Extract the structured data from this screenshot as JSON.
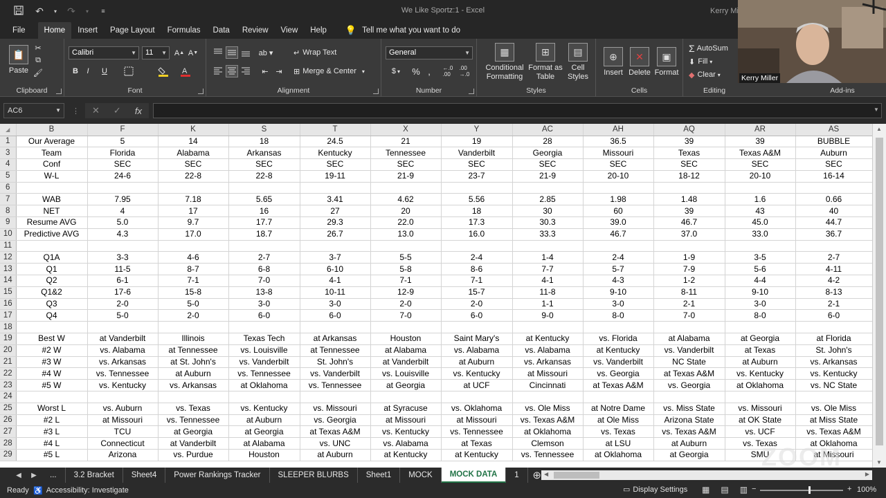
{
  "window": {
    "title": "We Like Sportz:1  -  Excel",
    "user": "Kerry Mil"
  },
  "qat": {
    "icons": [
      "save-icon",
      "undo-icon",
      "redo-icon",
      "customize-qat-icon"
    ]
  },
  "menu_tabs": [
    "File",
    "Home",
    "Insert",
    "Page Layout",
    "Formulas",
    "Data",
    "Review",
    "View",
    "Help"
  ],
  "tell_me": "Tell me what you want to do",
  "ribbon": {
    "clipboard": {
      "paste": "Paste",
      "label": "Clipboard"
    },
    "font": {
      "name": "Calibri",
      "size": "11",
      "label": "Font",
      "bold": "B",
      "italic": "I",
      "underline": "U"
    },
    "alignment": {
      "wrap": "Wrap Text",
      "merge": "Merge & Center",
      "label": "Alignment"
    },
    "number": {
      "format": "General",
      "currency": "$",
      "percent": "%",
      "comma": ",",
      "label": "Number"
    },
    "styles": {
      "conditional": [
        "Conditional",
        "Formatting"
      ],
      "format_table": [
        "Format as",
        "Table"
      ],
      "cell_styles": [
        "Cell",
        "Styles"
      ],
      "label": "Styles"
    },
    "cells": {
      "insert": "Insert",
      "delete": "Delete",
      "format": "Format",
      "label": "Cells"
    },
    "editing": {
      "autosum": "AutoSum",
      "fill": "Fill",
      "clear": "Clear",
      "label": "Editing"
    },
    "addins": {
      "label": "Add-ins"
    }
  },
  "formula_bar": {
    "name_box": "AC6",
    "formula": ""
  },
  "columns": [
    "B",
    "F",
    "K",
    "S",
    "T",
    "X",
    "Y",
    "AC",
    "AH",
    "AQ",
    "AR",
    "AS"
  ],
  "rows": [
    {
      "num": "1",
      "cells": [
        "Our Average",
        "5",
        "14",
        "18",
        "24.5",
        "21",
        "19",
        "28",
        "36.5",
        "39",
        "39",
        "BUBBLE"
      ]
    },
    {
      "num": "3",
      "cells": [
        "Team",
        "Florida",
        "Alabama",
        "Arkansas",
        "Kentucky",
        "Tennessee",
        "Vanderbilt",
        "Georgia",
        "Missouri",
        "Texas",
        "Texas A&M",
        "Auburn"
      ]
    },
    {
      "num": "4",
      "cells": [
        "Conf",
        "SEC",
        "SEC",
        "SEC",
        "SEC",
        "SEC",
        "SEC",
        "SEC",
        "SEC",
        "SEC",
        "SEC",
        "SEC"
      ]
    },
    {
      "num": "5",
      "cells": [
        "W-L",
        "24-6",
        "22-8",
        "22-8",
        "19-11",
        "21-9",
        "23-7",
        "21-9",
        "20-10",
        "18-12",
        "20-10",
        "16-14"
      ]
    },
    {
      "num": "6",
      "cells": [
        "",
        "",
        "",
        "",
        "",
        "",
        "",
        "",
        "",
        "",
        "",
        ""
      ]
    },
    {
      "num": "7",
      "cells": [
        "WAB",
        "7.95",
        "7.18",
        "5.65",
        "3.41",
        "4.62",
        "5.56",
        "2.85",
        "1.98",
        "1.48",
        "1.6",
        "0.66"
      ]
    },
    {
      "num": "8",
      "cells": [
        "NET",
        "4",
        "17",
        "16",
        "27",
        "20",
        "18",
        "30",
        "60",
        "39",
        "43",
        "40"
      ]
    },
    {
      "num": "9",
      "cells": [
        "Resume AVG",
        "5.0",
        "9.7",
        "17.7",
        "29.3",
        "22.0",
        "17.3",
        "30.3",
        "39.0",
        "46.7",
        "45.0",
        "44.7"
      ]
    },
    {
      "num": "10",
      "cells": [
        "Predictive AVG",
        "4.3",
        "17.0",
        "18.7",
        "26.7",
        "13.0",
        "16.0",
        "33.3",
        "46.7",
        "37.0",
        "33.0",
        "36.7"
      ]
    },
    {
      "num": "11",
      "cells": [
        "",
        "",
        "",
        "",
        "",
        "",
        "",
        "",
        "",
        "",
        "",
        ""
      ]
    },
    {
      "num": "12",
      "cells": [
        "Q1A",
        "3-3",
        "4-6",
        "2-7",
        "3-7",
        "5-5",
        "2-4",
        "1-4",
        "2-4",
        "1-9",
        "3-5",
        "2-7"
      ]
    },
    {
      "num": "13",
      "cells": [
        "Q1",
        "11-5",
        "8-7",
        "6-8",
        "6-10",
        "5-8",
        "8-6",
        "7-7",
        "5-7",
        "7-9",
        "5-6",
        "4-11"
      ]
    },
    {
      "num": "14",
      "cells": [
        "Q2",
        "6-1",
        "7-1",
        "7-0",
        "4-1",
        "7-1",
        "7-1",
        "4-1",
        "4-3",
        "1-2",
        "4-4",
        "4-2"
      ]
    },
    {
      "num": "15",
      "cells": [
        "Q1&2",
        "17-6",
        "15-8",
        "13-8",
        "10-11",
        "12-9",
        "15-7",
        "11-8",
        "9-10",
        "8-11",
        "9-10",
        "8-13"
      ]
    },
    {
      "num": "16",
      "cells": [
        "Q3",
        "2-0",
        "5-0",
        "3-0",
        "3-0",
        "2-0",
        "2-0",
        "1-1",
        "3-0",
        "2-1",
        "3-0",
        "2-1"
      ]
    },
    {
      "num": "17",
      "cells": [
        "Q4",
        "5-0",
        "2-0",
        "6-0",
        "6-0",
        "7-0",
        "6-0",
        "9-0",
        "8-0",
        "7-0",
        "8-0",
        "6-0"
      ]
    },
    {
      "num": "18",
      "cells": [
        "",
        "",
        "",
        "",
        "",
        "",
        "",
        "",
        "",
        "",
        "",
        ""
      ]
    },
    {
      "num": "19",
      "cells": [
        "Best W",
        "at Vanderbilt",
        "Illinois",
        "Texas Tech",
        "at Arkansas",
        "Houston",
        "Saint Mary's",
        "at Kentucky",
        "vs. Florida",
        "at Alabama",
        "at Georgia",
        "at Florida"
      ]
    },
    {
      "num": "20",
      "cells": [
        "#2 W",
        "vs. Alabama",
        "at Tennessee",
        "vs. Louisville",
        "at Tennessee",
        "at Alabama",
        "vs. Alabama",
        "vs. Alabama",
        "at Kentucky",
        "vs. Vanderbilt",
        "at Texas",
        "St. John's"
      ]
    },
    {
      "num": "21",
      "cells": [
        "#3 W",
        "vs. Arkansas",
        "at St. John's",
        "vs. Vanderbilt",
        "St. John's",
        "at Vanderbilt",
        "at Auburn",
        "vs. Arkansas",
        "vs. Vanderbilt",
        "NC State",
        "at Auburn",
        "vs. Arkansas"
      ]
    },
    {
      "num": "22",
      "cells": [
        "#4 W",
        "vs. Tennessee",
        "at Auburn",
        "vs. Tennessee",
        "vs. Vanderbilt",
        "vs. Louisville",
        "vs. Kentucky",
        "at Missouri",
        "vs. Georgia",
        "at Texas A&M",
        "vs. Kentucky",
        "vs. Kentucky"
      ]
    },
    {
      "num": "23",
      "cells": [
        "#5 W",
        "vs. Kentucky",
        "vs. Arkansas",
        "at Oklahoma",
        "vs. Tennessee",
        "at Georgia",
        "at UCF",
        "Cincinnati",
        "at Texas A&M",
        "vs. Georgia",
        "at Oklahoma",
        "vs. NC State"
      ]
    },
    {
      "num": "24",
      "cells": [
        "",
        "",
        "",
        "",
        "",
        "",
        "",
        "",
        "",
        "",
        "",
        ""
      ]
    },
    {
      "num": "25",
      "cells": [
        "Worst L",
        "vs. Auburn",
        "vs. Texas",
        "vs. Kentucky",
        "vs. Missouri",
        "at Syracuse",
        "vs. Oklahoma",
        "vs. Ole Miss",
        "at Notre Dame",
        "vs. Miss State",
        "vs. Missouri",
        "vs. Ole Miss"
      ]
    },
    {
      "num": "26",
      "cells": [
        "#2 L",
        "at Missouri",
        "vs. Tennessee",
        "at Auburn",
        "vs. Georgia",
        "at Missouri",
        "at Missouri",
        "vs. Texas A&M",
        "at Ole Miss",
        "Arizona State",
        "at OK State",
        "at Miss State"
      ]
    },
    {
      "num": "27",
      "cells": [
        "#3 L",
        "TCU",
        "at Georgia",
        "at Georgia",
        "at Texas A&M",
        "vs. Kentucky",
        "vs. Tennessee",
        "at Oklahoma",
        "vs. Texas",
        "vs. Texas A&M",
        "vs. UCF",
        "vs. Texas A&M"
      ]
    },
    {
      "num": "28",
      "cells": [
        "#4 L",
        "Connecticut",
        "at Vanderbilt",
        "at Alabama",
        "vs. UNC",
        "vs. Alabama",
        "at Texas",
        "Clemson",
        "at LSU",
        "at Auburn",
        "vs. Texas",
        "at Oklahoma"
      ]
    },
    {
      "num": "29",
      "cells": [
        "#5 L",
        "Arizona",
        "vs. Purdue",
        "Houston",
        "at Auburn",
        "at Kentucky",
        "at Kentucky",
        "vs. Tennessee",
        "at Oklahoma",
        "at Georgia",
        "SMU",
        "at Missouri"
      ]
    }
  ],
  "sheet_tabs": {
    "overflow": "...",
    "tabs": [
      "3.2 Bracket",
      "Sheet4",
      "Power Rankings Tracker",
      "SLEEPER BLURBS",
      "Sheet1",
      "MOCK",
      "MOCK DATA",
      "1"
    ],
    "active": "MOCK DATA"
  },
  "status": {
    "ready": "Ready",
    "accessibility": "Accessibility: Investigate",
    "display_settings": "Display Settings",
    "zoom": "100%"
  },
  "webcam": {
    "name": "Kerry Miller"
  },
  "watermark": "ZOOM",
  "colors": {
    "excel_green": "#217346",
    "ribbon_bg": "#3a3a3a",
    "title_bg": "#262626"
  }
}
